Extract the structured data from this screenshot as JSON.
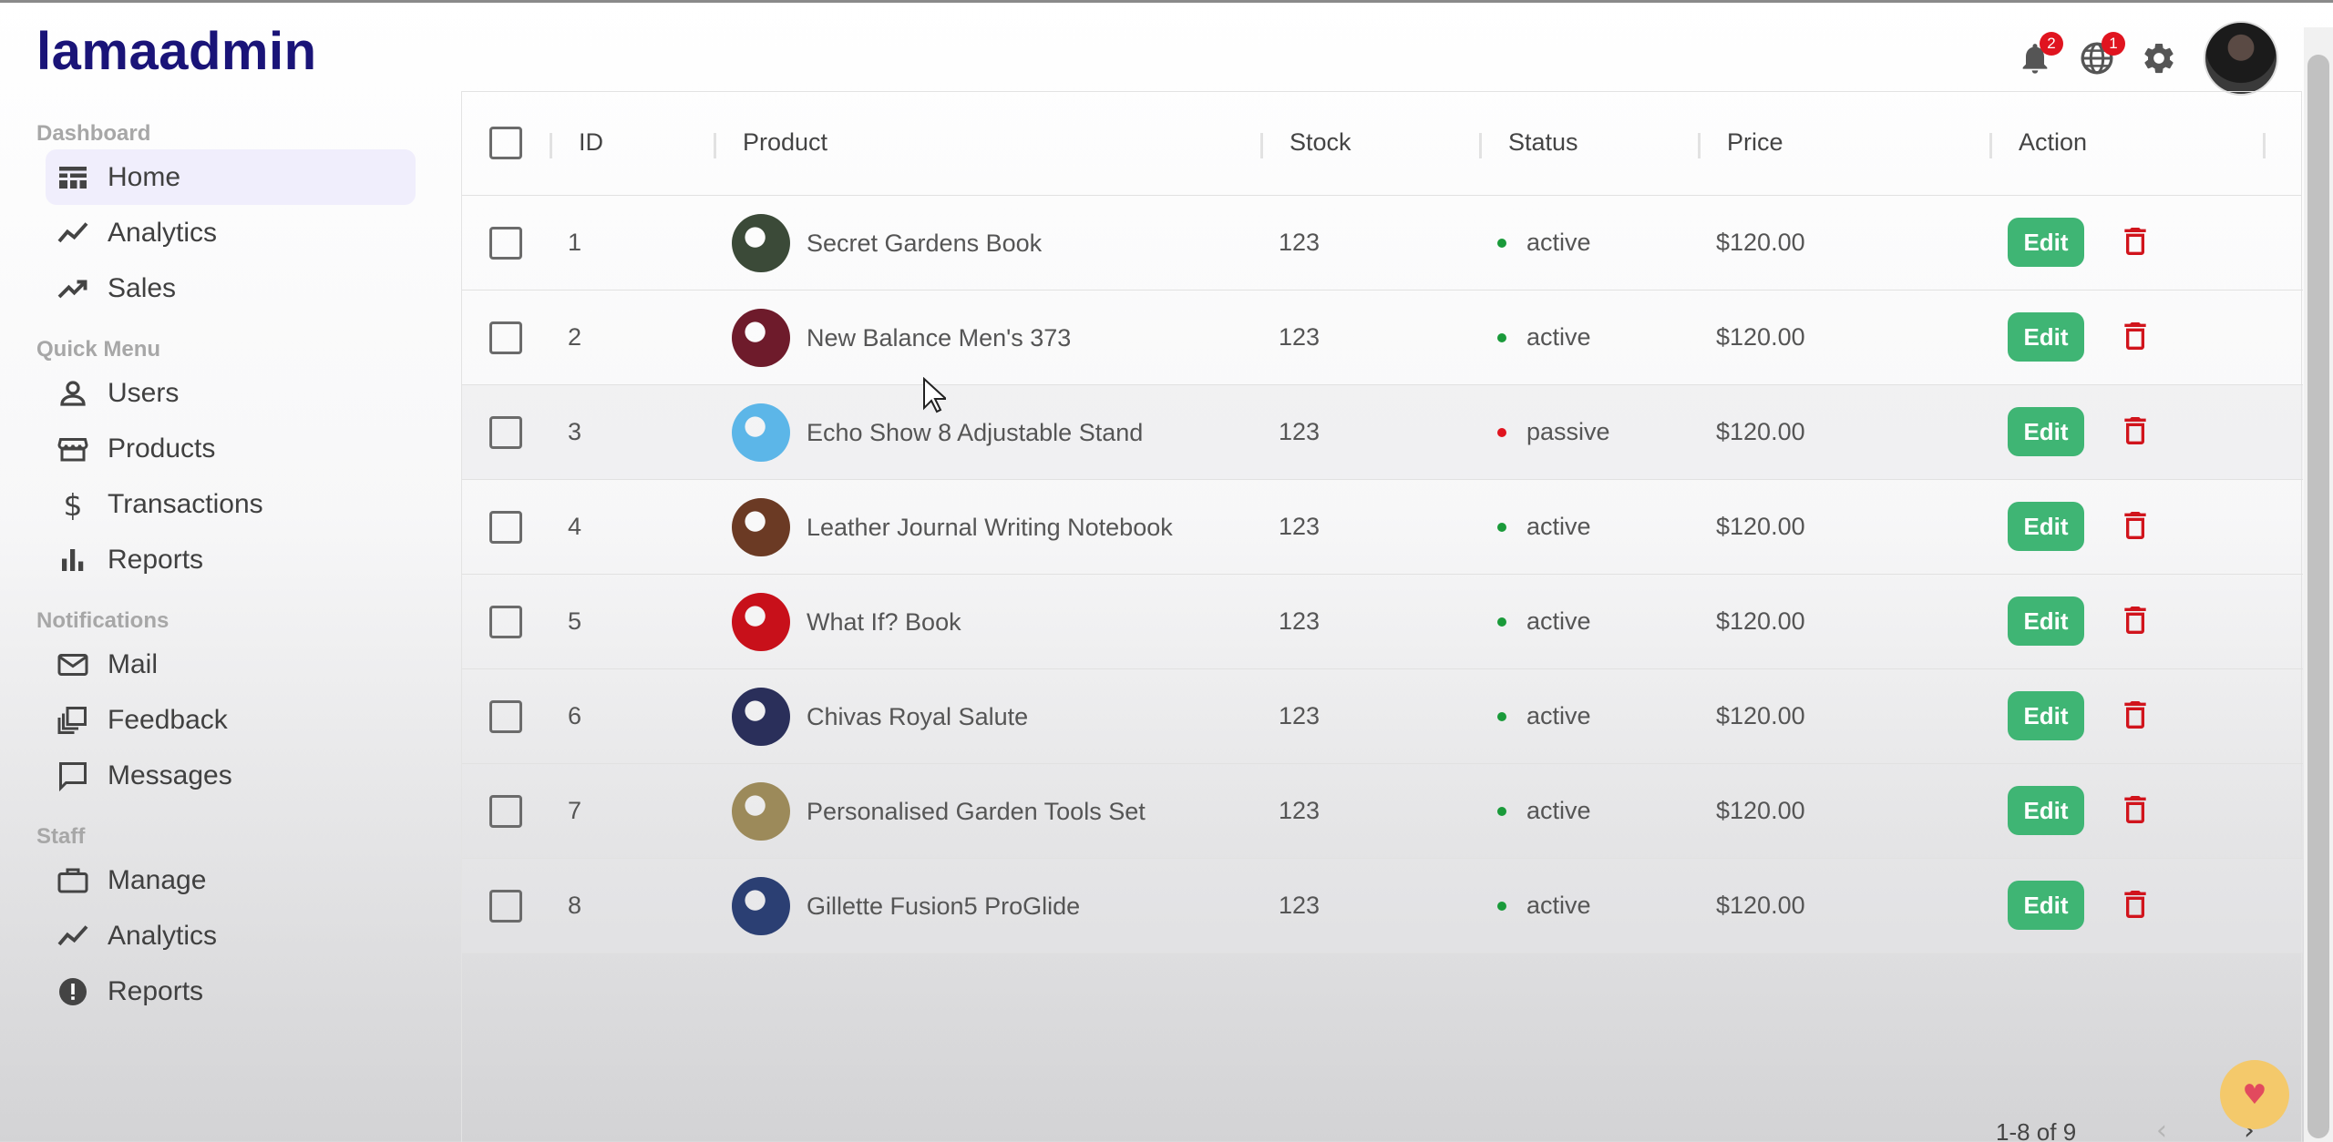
{
  "app": {
    "logo": "lamaadmin"
  },
  "topbar": {
    "notifications_badge": "2",
    "language_badge": "1"
  },
  "sidebar": {
    "sections": [
      {
        "title": "Dashboard",
        "items": [
          {
            "label": "Home",
            "icon": "home-icon"
          },
          {
            "label": "Analytics",
            "icon": "analytics-icon"
          },
          {
            "label": "Sales",
            "icon": "trending-up-icon"
          }
        ]
      },
      {
        "title": "Quick Menu",
        "items": [
          {
            "label": "Users",
            "icon": "user-icon"
          },
          {
            "label": "Products",
            "icon": "store-icon"
          },
          {
            "label": "Transactions",
            "icon": "dollar-icon"
          },
          {
            "label": "Reports",
            "icon": "bar-chart-icon"
          }
        ]
      },
      {
        "title": "Notifications",
        "items": [
          {
            "label": "Mail",
            "icon": "mail-icon"
          },
          {
            "label": "Feedback",
            "icon": "feedback-icon"
          },
          {
            "label": "Messages",
            "icon": "chat-icon"
          }
        ]
      },
      {
        "title": "Staff",
        "items": [
          {
            "label": "Manage",
            "icon": "briefcase-icon"
          },
          {
            "label": "Analytics",
            "icon": "analytics-icon"
          },
          {
            "label": "Reports",
            "icon": "report-icon"
          }
        ]
      }
    ]
  },
  "table": {
    "headers": {
      "id": "ID",
      "product": "Product",
      "stock": "Stock",
      "status": "Status",
      "price": "Price",
      "action": "Action"
    },
    "edit_label": "Edit",
    "rows": [
      {
        "id": "1",
        "product": "Secret Gardens Book",
        "stock": "123",
        "status": "active",
        "price": "$120.00",
        "status_color": "#1a9a3a",
        "img_color": "#3b4a38"
      },
      {
        "id": "2",
        "product": "New Balance Men's 373",
        "stock": "123",
        "status": "active",
        "price": "$120.00",
        "status_color": "#1a9a3a",
        "img_color": "#6e1b2b"
      },
      {
        "id": "3",
        "product": "Echo Show 8 Adjustable Stand",
        "stock": "123",
        "status": "passive",
        "price": "$120.00",
        "status_color": "#e0141f",
        "img_color": "#5cb6e8"
      },
      {
        "id": "4",
        "product": "Leather Journal Writing Notebook",
        "stock": "123",
        "status": "active",
        "price": "$120.00",
        "status_color": "#1a9a3a",
        "img_color": "#6b3a24"
      },
      {
        "id": "5",
        "product": "What If? Book",
        "stock": "123",
        "status": "active",
        "price": "$120.00",
        "status_color": "#1a9a3a",
        "img_color": "#c8101a"
      },
      {
        "id": "6",
        "product": "Chivas Royal Salute",
        "stock": "123",
        "status": "active",
        "price": "$120.00",
        "status_color": "#1a9a3a",
        "img_color": "#2a2f5a"
      },
      {
        "id": "7",
        "product": "Personalised Garden Tools Set",
        "stock": "123",
        "status": "active",
        "price": "$120.00",
        "status_color": "#1a9a3a",
        "img_color": "#9c8a5a"
      },
      {
        "id": "8",
        "product": "Gillette Fusion5 ProGlide",
        "stock": "123",
        "status": "active",
        "price": "$120.00",
        "status_color": "#1a9a3a",
        "img_color": "#2b3f73"
      }
    ]
  },
  "pagination": {
    "range": "1-8 of 9"
  }
}
